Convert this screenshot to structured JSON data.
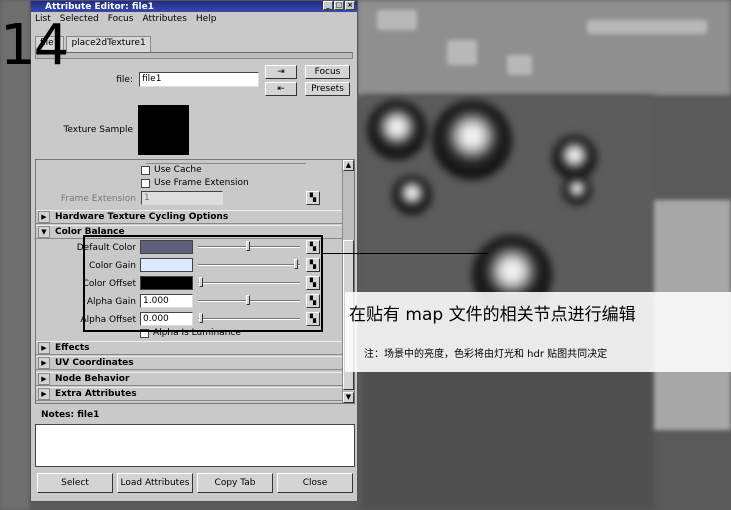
{
  "window": {
    "title": "Attribute Editor: file1",
    "menu": [
      "List",
      "Selected",
      "Focus",
      "Attributes",
      "Help"
    ],
    "tabs": [
      "file1",
      "place2dTexture1"
    ]
  },
  "file_row": {
    "label": "file:",
    "value": "file1",
    "focus_label": "Focus",
    "presets_label": "Presets"
  },
  "texture_sample_label": "Texture Sample",
  "options": {
    "use_cache": "Use Cache",
    "use_frame_extension": "Use Frame Extension",
    "frame_extension_label": "Frame Extension",
    "frame_extension_value": "1"
  },
  "sections": {
    "hardware": "Hardware Texture Cycling Options",
    "color_balance": "Color Balance",
    "effects": "Effects",
    "uv": "UV Coordinates",
    "node_behavior": "Node Behavior",
    "extra": "Extra Attributes"
  },
  "color_balance": {
    "default_color": "Default Color",
    "color_gain": "Color Gain",
    "color_offset": "Color Offset",
    "alpha_gain": "Alpha Gain",
    "alpha_gain_value": "1.000",
    "alpha_offset": "Alpha Offset",
    "alpha_offset_value": "0.000",
    "alpha_is_luminance": "Alpha Is Luminance",
    "default_color_hex": "#5e5f78",
    "color_gain_hex": "#dde9ff",
    "color_offset_hex": "#000000"
  },
  "notes": {
    "label": "Notes: file1",
    "value": ""
  },
  "buttons": {
    "select": "Select",
    "load": "Load Attributes",
    "copy": "Copy Tab",
    "close": "Close"
  },
  "overlay": {
    "step_number": "14",
    "caption": "在贴有 map 文件的相关节点进行编辑",
    "note": "注：场景中的亮度，色彩将由灯光和 hdr 贴图共同决定"
  }
}
